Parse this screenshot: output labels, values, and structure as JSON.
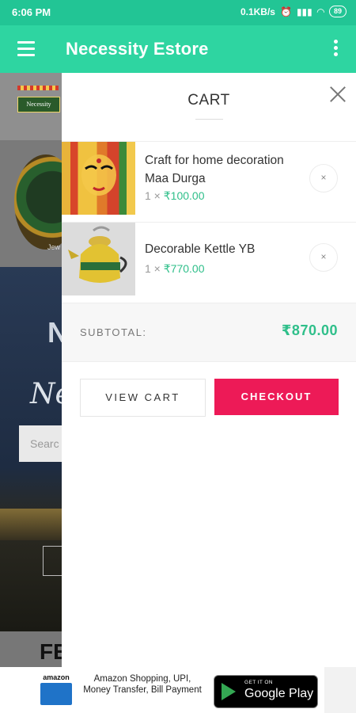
{
  "status_bar": {
    "time": "6:06 PM",
    "network_speed": "0.1KB/s",
    "battery": "89"
  },
  "app_bar": {
    "title": "Necessity Estore"
  },
  "background": {
    "logo_text": "Necessity",
    "category_caption": "Jew",
    "hero_text_1": "N",
    "hero_text_2": "Ne",
    "search_placeholder": "Searc",
    "featured_text": "FE"
  },
  "cart": {
    "title": "CART",
    "items": [
      {
        "name": "Craft for home decoration Maa Durga",
        "qty": "1",
        "price": "₹100.00"
      },
      {
        "name": "Decorable Kettle YB",
        "qty": "1",
        "price": "₹770.00"
      }
    ],
    "subtotal_label": "SUBTOTAL:",
    "subtotal_value": "₹870.00",
    "view_cart_label": "VIEW CART",
    "checkout_label": "CHECKOUT"
  },
  "ad": {
    "amazon_word": "amazon",
    "text": "Amazon Shopping, UPI, Money Transfer, Bill Payment",
    "store_small": "GET IT ON",
    "store_big": "Google Play"
  },
  "colors": {
    "app_bar": "#2ed5a1",
    "status_bar": "#22c595",
    "accent_green": "#2fbf8a",
    "checkout": "#ed1a57"
  }
}
